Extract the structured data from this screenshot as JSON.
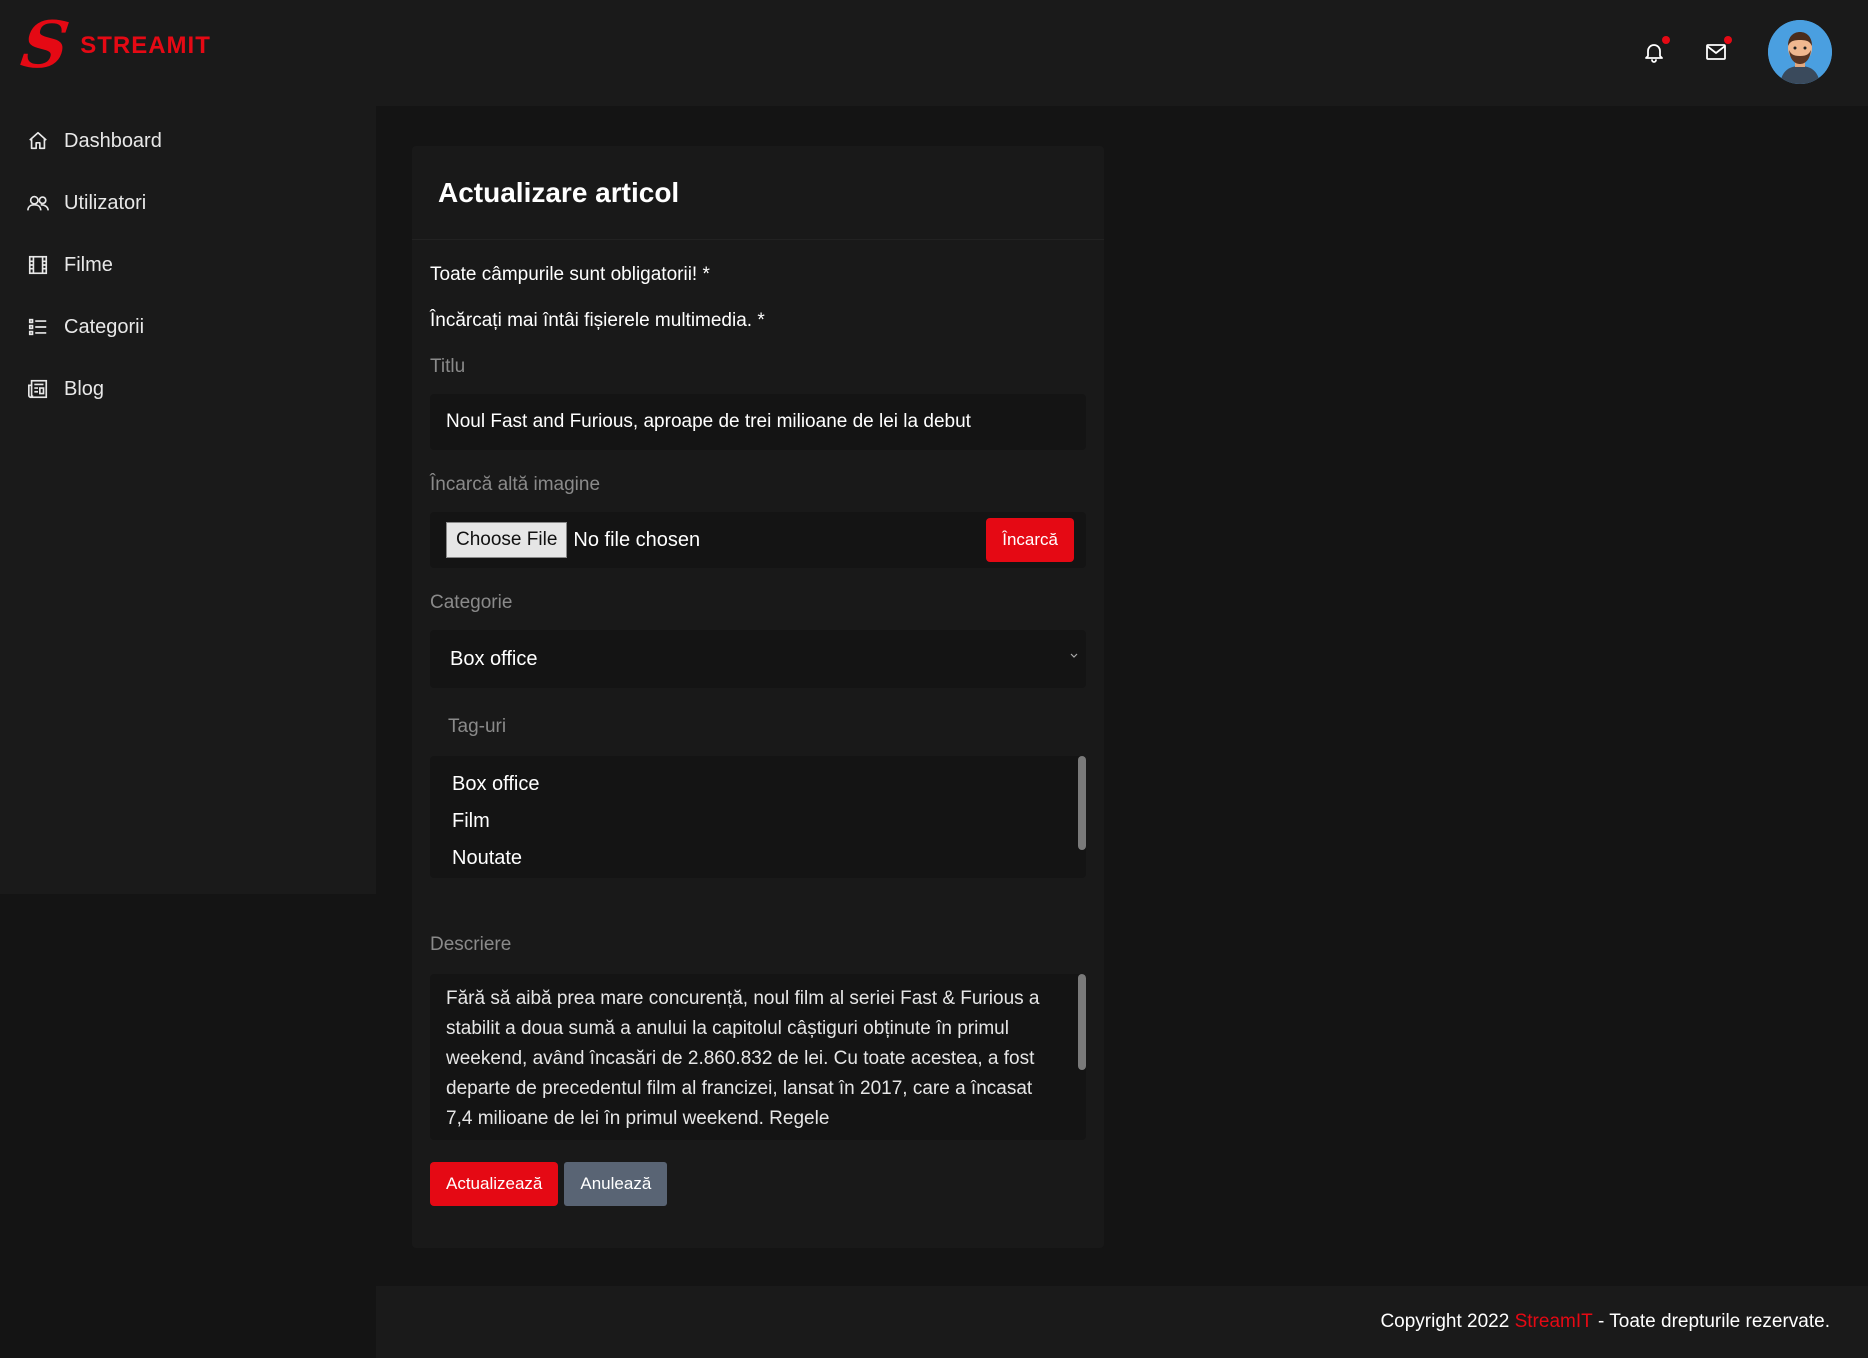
{
  "brand": {
    "name": "STREAMIT",
    "logo_letter": "S",
    "accent_color": "#e50914"
  },
  "header": {
    "icons": [
      "bell-icon",
      "mail-icon"
    ],
    "notification_dot_color": "#e50914"
  },
  "sidebar": {
    "items": [
      {
        "label": "Dashboard",
        "icon": "home-icon"
      },
      {
        "label": "Utilizatori",
        "icon": "users-icon"
      },
      {
        "label": "Filme",
        "icon": "film-icon"
      },
      {
        "label": "Categorii",
        "icon": "list-icon"
      },
      {
        "label": "Blog",
        "icon": "newspaper-icon"
      }
    ]
  },
  "form": {
    "title": "Actualizare articol",
    "note_required": "Toate câmpurile sunt obligatorii! *",
    "note_media": "Încărcați mai întâi fișierele multimedia. *",
    "title_label": "Titlu",
    "title_value": "Noul Fast and Furious, aproape de trei milioane de lei la debut",
    "image_label": "Încarcă altă imagine",
    "choose_file": "Choose File",
    "no_file": "No file chosen",
    "upload_button": "Încarcă",
    "category_label": "Categorie",
    "category_value": "Box office",
    "tags_label": "Tag-uri",
    "tags": [
      "Box office",
      "Film",
      "Noutate"
    ],
    "description_label": "Descriere",
    "description_value": "Fără să aibă prea mare concurență, noul film al seriei Fast & Furious a stabilit a doua sumă a anului la capitolul câștiguri obținute în primul weekend, având încasări de 2.860.832 de lei. Cu toate acestea, a fost departe de precedentul film al francizei, lansat în 2017, care a încasat 7,4 milioane de lei în primul weekend. Regele",
    "submit_button": "Actualizează",
    "cancel_button": "Anulează"
  },
  "footer": {
    "prefix": "Copyright 2022 ",
    "brand": "StreamIT",
    "suffix": " - Toate drepturile rezervate."
  }
}
